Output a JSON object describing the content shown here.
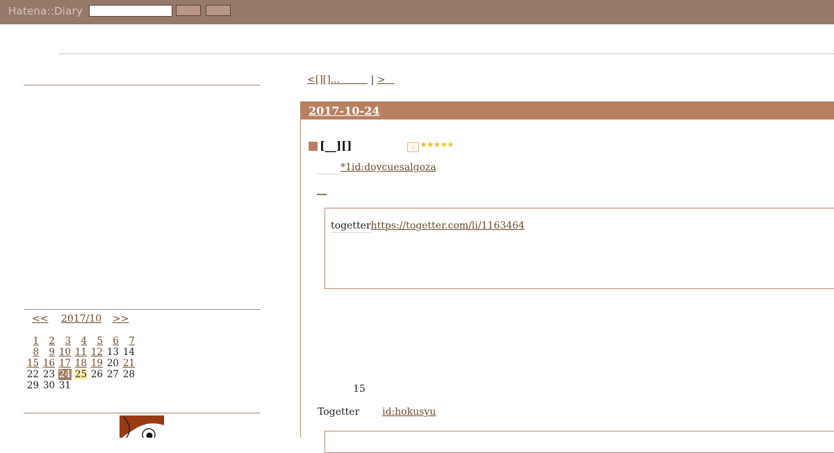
{
  "header": {
    "logo": "Hatena::Diary",
    "search_placeholder": ""
  },
  "pager": {
    "prev_label": "<[][]...",
    "separator": "|",
    "next_label": ">"
  },
  "calendar": {
    "prev_label": "<<",
    "month_label": "2017/10",
    "next_label": ">>",
    "weeks": [
      [
        {
          "d": "1",
          "link": true
        },
        {
          "d": "2",
          "link": true
        },
        {
          "d": "3",
          "link": true
        },
        {
          "d": "4",
          "link": true
        },
        {
          "d": "5",
          "link": true
        },
        {
          "d": "6",
          "link": true
        },
        {
          "d": "7",
          "link": true
        }
      ],
      [
        {
          "d": "8",
          "link": true
        },
        {
          "d": "9",
          "link": true
        },
        {
          "d": "10",
          "link": true
        },
        {
          "d": "11",
          "link": true
        },
        {
          "d": "12",
          "link": true
        },
        {
          "d": "13",
          "link": false
        },
        {
          "d": "14",
          "link": false
        }
      ],
      [
        {
          "d": "15",
          "link": true
        },
        {
          "d": "16",
          "link": true
        },
        {
          "d": "17",
          "link": true
        },
        {
          "d": "18",
          "link": true
        },
        {
          "d": "19",
          "link": true
        },
        {
          "d": "20",
          "link": false
        },
        {
          "d": "21",
          "link": true
        }
      ],
      [
        {
          "d": "22",
          "link": false
        },
        {
          "d": "23",
          "link": false
        },
        {
          "d": "24",
          "link": true,
          "today": true
        },
        {
          "d": "25",
          "link": false,
          "hl": true
        },
        {
          "d": "26",
          "link": false
        },
        {
          "d": "27",
          "link": false
        },
        {
          "d": "28",
          "link": false
        }
      ],
      [
        {
          "d": "29",
          "link": false
        },
        {
          "d": "30",
          "link": false
        },
        {
          "d": "31",
          "link": false
        },
        {
          "d": "",
          "link": false
        },
        {
          "d": "",
          "link": false
        },
        {
          "d": "",
          "link": false
        },
        {
          "d": "",
          "link": false
        }
      ]
    ]
  },
  "entry": {
    "date": "2017-10-24",
    "section_title": "[__][]",
    "author_link": "*1id:doycuesalgoza",
    "small_link": "__",
    "quote_prefix": "togetter",
    "quote_url": "https://togetter.com/li/1163464",
    "count_text": "15",
    "togetter_label": "Togetter",
    "hokusyu_link": "id:hokusyu"
  },
  "colors": {
    "header_bg": "#97796a",
    "accent": "#b88060",
    "link": "#6b4a2b",
    "star": "#f0c030"
  }
}
